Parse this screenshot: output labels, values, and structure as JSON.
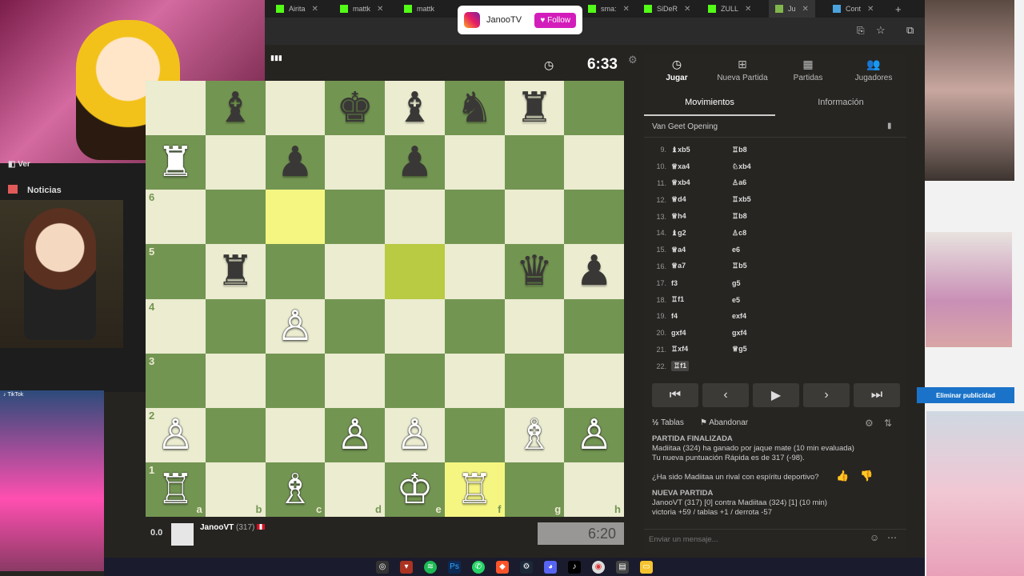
{
  "browser": {
    "tabs": [
      "Airita",
      "mattk",
      "mattk",
      "sma:",
      "SiDeR",
      "ZULL",
      "Ju",
      "Cont"
    ],
    "new_tab": "+"
  },
  "overlay": {
    "instagram_handle": "JanooTV",
    "follow_label": "Follow",
    "sidebar_items": [
      "Ver",
      "Noticias"
    ],
    "tiktok_label": "TikTok",
    "ad_remove_label": "Eliminar publicidad"
  },
  "opponent": {
    "flag_label": "▮▮▮",
    "clock": "6:33"
  },
  "player": {
    "score": "0.0",
    "name": "JanooVT",
    "rating": "(317)",
    "clock": "6:20"
  },
  "board": {
    "files": [
      "a",
      "b",
      "c",
      "d",
      "e",
      "f",
      "g",
      "h"
    ],
    "ranks": [
      "6",
      "5",
      "4",
      "3",
      "2",
      "1"
    ],
    "rows": [
      [
        "",
        "b:♝",
        "",
        "b:♚",
        "b:♝",
        "b:♞",
        "b:♜",
        ""
      ],
      [
        "w:♜",
        "",
        "b:♟",
        "",
        "b:♟",
        "",
        "",
        ""
      ],
      [
        "",
        "",
        "",
        "",
        "",
        "",
        "",
        ""
      ],
      [
        "",
        "b:♜",
        "",
        "",
        "",
        "",
        "b:♛",
        "b:♟"
      ],
      [
        "",
        "",
        "w:♙",
        "",
        "",
        "",
        "",
        ""
      ],
      [
        "",
        "",
        "",
        "",
        "",
        "",
        "",
        ""
      ],
      [
        "w:♙",
        "",
        "",
        "w:♙",
        "w:♙",
        "",
        "w:♗",
        "w:♙"
      ],
      [
        "w:♖",
        "",
        "w:♗",
        "",
        "w:♔",
        "w:♖",
        "",
        ""
      ]
    ],
    "colors": {
      "light": "#ebecd0",
      "dark": "#739552",
      "highlight_light": "#f5f682",
      "highlight_dark": "#b9ca43"
    }
  },
  "panel": {
    "nav": [
      {
        "label": "Jugar",
        "icon": "clock-icon"
      },
      {
        "label": "Nueva Partida",
        "icon": "plus-icon"
      },
      {
        "label": "Partidas",
        "icon": "board-icon"
      },
      {
        "label": "Jugadores",
        "icon": "users-icon"
      }
    ],
    "tabs": [
      "Movimientos",
      "Información"
    ],
    "opening": "Van Geet Opening",
    "moves": [
      {
        "n": "9.",
        "w": "♝xb5",
        "b": "♖b8"
      },
      {
        "n": "10.",
        "w": "♕xa4",
        "b": "♘xb4"
      },
      {
        "n": "11.",
        "w": "♕xb4",
        "b": "♙a6"
      },
      {
        "n": "12.",
        "w": "♕d4",
        "b": "♖xb5"
      },
      {
        "n": "13.",
        "w": "♕h4",
        "b": "♖b8"
      },
      {
        "n": "14.",
        "w": "♝g2",
        "b": "♙c8"
      },
      {
        "n": "15.",
        "w": "♕a4",
        "b": "e6"
      },
      {
        "n": "16.",
        "w": "♕a7",
        "b": "♖b5"
      },
      {
        "n": "17.",
        "w": "f3",
        "b": "g5"
      },
      {
        "n": "18.",
        "w": "♖f1",
        "b": "e5"
      },
      {
        "n": "19.",
        "w": "f4",
        "b": "exf4"
      },
      {
        "n": "20.",
        "w": "gxf4",
        "b": "gxf4"
      },
      {
        "n": "21.",
        "w": "♖xf4",
        "b": "♕g5"
      },
      {
        "n": "22.",
        "w": "♖f1",
        "b": ""
      }
    ],
    "draw_label": "Tablas",
    "resign_label": "Abandonar",
    "chat": [
      "PARTIDA FINALIZADA",
      "Madiitaa (324) ha ganado por jaque mate (10 min evaluada)",
      "Tu nueva puntuación Rápida es de 317 (-98).",
      "¿Ha sido Madiitaa un rival con espíritu deportivo?",
      "NUEVA PARTIDA",
      "JanooVT (317) [0] contra Madiitaa (324) [1] (10 min)",
      "victoria +59 / tablas +1 / derrota -57"
    ],
    "chat_placeholder": "Enviar un mensaje..."
  }
}
